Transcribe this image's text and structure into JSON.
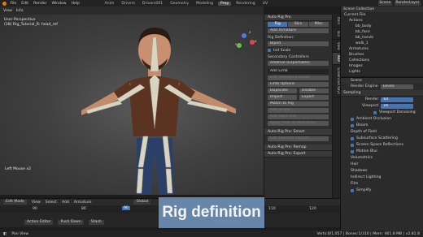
{
  "topbar": {
    "menus": [
      "File",
      "Edit",
      "Render",
      "Window",
      "Help"
    ],
    "workspaces": [
      "Anim",
      "Drivers",
      "Drivers001",
      "Geometry",
      "Modeling",
      "Prep",
      "Rendering",
      "UV"
    ],
    "scene": "Scene",
    "view_layer": "RenderLayer"
  },
  "toolhdr": {
    "view": "View",
    "info": "Info"
  },
  "viewport": {
    "overlay_line1": "User Perspective",
    "overlay_line2": "(38) Rig_Tutorial_R: head_ref",
    "object_label": "Left Mouse x2",
    "gizmo_x": "X",
    "gizmo_y": "Y",
    "gizmo_z": "Z"
  },
  "rigpanel": {
    "title": "Auto-Rig Pro",
    "tabs": [
      "Rig",
      "Skin",
      "Misc"
    ],
    "add_armature": "Add Armature",
    "rig_definition": "Rig Definition:",
    "definition_value": "Biped",
    "init_scale": "Init Scale",
    "secondary_controllers": "Secondary Controllers",
    "secondary_value": "Additive (Exportable)",
    "add_limb": "Add Limb",
    "edit_reference_bones": "Edit Reference Bones",
    "limb_options": "Limb Options",
    "duplicate": "Duplicate",
    "disable": "Disable",
    "import": "Import",
    "export": "Export",
    "match_to_rig": "Match to Rig",
    "add_shape": "Add Shape",
    "add_hand_fist": "Add Hand Fist",
    "apply_pose": "Apply Pose as Rest Pose",
    "smart_title": "Auto-Rig Pro: Smart",
    "get_selected": "Get Selected Objects",
    "remap_title": "Auto-Rig Pro: Remap",
    "export_title": "Auto-Rig Pro: Export"
  },
  "vtabs": [
    "Item",
    "Tool",
    "View",
    "ARP",
    "Screencast Keys"
  ],
  "outliner": {
    "title": "Scene Collection",
    "items": [
      "Current File",
      "Actions",
      "bb_body",
      "bb_face",
      "bb_hands",
      "walk_1",
      "Armatures",
      "Brushes",
      "Collections",
      "Images",
      "Lights",
      "Line Styles"
    ]
  },
  "props": {
    "scene": "Scene",
    "render_engine_label": "Render Engine",
    "render_engine": "Eevee",
    "sampling": "Sampling",
    "render_label": "Render",
    "render_val": "64",
    "viewport_label": "Viewport",
    "viewport_val": "16",
    "viewport_denoising": "Viewport Denoising",
    "sections": [
      "Ambient Occlusion",
      "Bloom",
      "Depth of Field",
      "Subsurface Scattering",
      "Screen Space Reflections",
      "Motion Blur",
      "Volumetrics",
      "Hair",
      "Shadows",
      "Indirect Lighting",
      "Film",
      "Simplify"
    ]
  },
  "editmode": {
    "mode": "Edit Mode",
    "menus": [
      "View",
      "Select",
      "Add",
      "Armature"
    ],
    "orientation": "Global"
  },
  "timeline": {
    "frames": [
      "90",
      "80",
      "90",
      "100",
      "110",
      "120"
    ],
    "current": "90",
    "action_editor": "Action Editor",
    "push_down": "Push Down",
    "stash": "Stash",
    "playback": "Nearest Frame"
  },
  "status": {
    "left": "Pan View",
    "right": "Verts:0/1,057 | Bones:1/310 | Mem: 461.8 MB | v2.81.8"
  },
  "caption": "Rig definition",
  "colors": {
    "accent": "#4772b3",
    "caption_bg": "#6b8bb0",
    "blender_orange": "#e87d0d"
  }
}
